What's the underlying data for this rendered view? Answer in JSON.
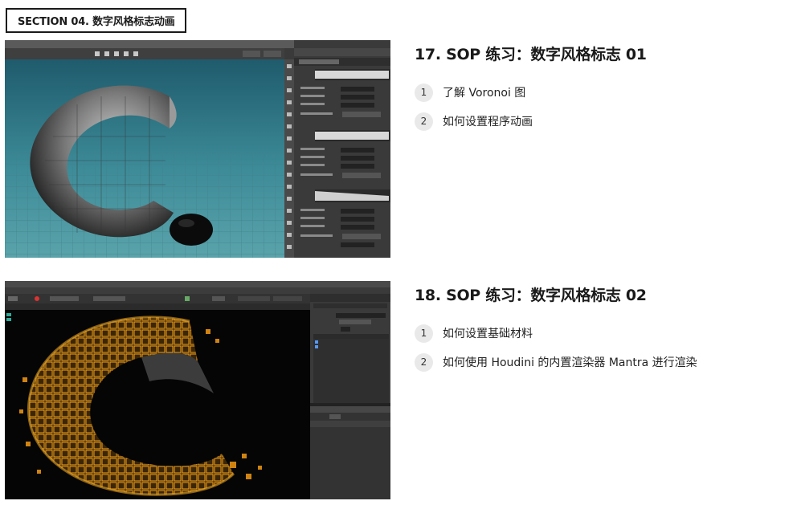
{
  "section": {
    "label": "SECTION 04. 数字风格标志动画"
  },
  "lessons": [
    {
      "title": "17. SOP 练习：数字风格标志 01",
      "items": [
        {
          "num": "1",
          "text": "了解 Voronoi 图"
        },
        {
          "num": "2",
          "text": "如何设置程序动画"
        }
      ]
    },
    {
      "title": "18. SOP 练习：数字风格标志 02",
      "items": [
        {
          "num": "1",
          "text": "如何设置基础材料"
        },
        {
          "num": "2",
          "text": "如何使用 Houdini 的内置渲染器 Mantra 进行渲染"
        }
      ]
    }
  ]
}
